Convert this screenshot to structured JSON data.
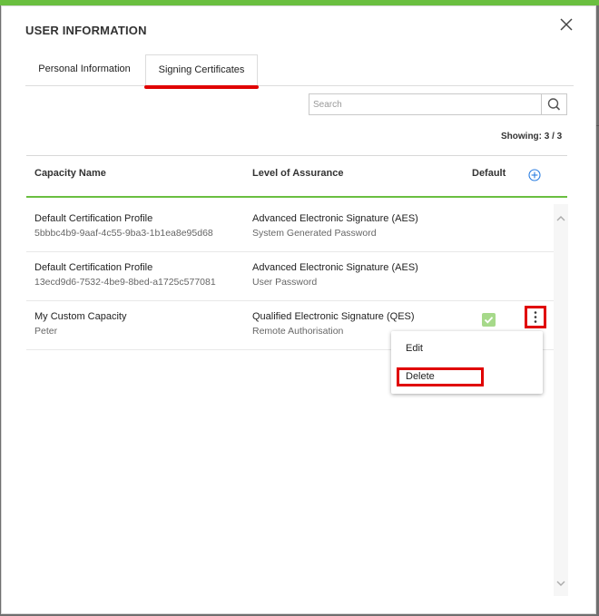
{
  "dialog": {
    "title": "USER INFORMATION",
    "tabs": [
      {
        "label": "Personal Information"
      },
      {
        "label": "Signing Certificates"
      }
    ]
  },
  "search": {
    "placeholder": "Search",
    "value": ""
  },
  "showing": "Showing: 3 / 3",
  "table": {
    "columns": [
      "Capacity Name",
      "Level of Assurance",
      "Default"
    ],
    "rows": [
      {
        "name": "Default Certification Profile",
        "id": "5bbbc4b9-9aaf-4c55-9ba3-1b1ea8e95d68",
        "loa": "Advanced Electronic Signature (AES)",
        "method": "System Generated Password",
        "default": false
      },
      {
        "name": "Default Certification Profile",
        "id": "13ecd9d6-7532-4be9-8bed-a1725c577081",
        "loa": "Advanced Electronic Signature (AES)",
        "method": "User Password",
        "default": false
      },
      {
        "name": "My Custom Capacity",
        "id": "Peter",
        "loa": "Qualified Electronic Signature (QES)",
        "method": "Remote Authorisation",
        "default": true
      }
    ]
  },
  "context_menu": {
    "items": [
      "Edit",
      "Delete"
    ]
  },
  "colors": {
    "accent_green": "#6abf40",
    "highlight_red": "#e00000",
    "add_blue": "#2a7de1",
    "check_green": "#a6d98a"
  }
}
